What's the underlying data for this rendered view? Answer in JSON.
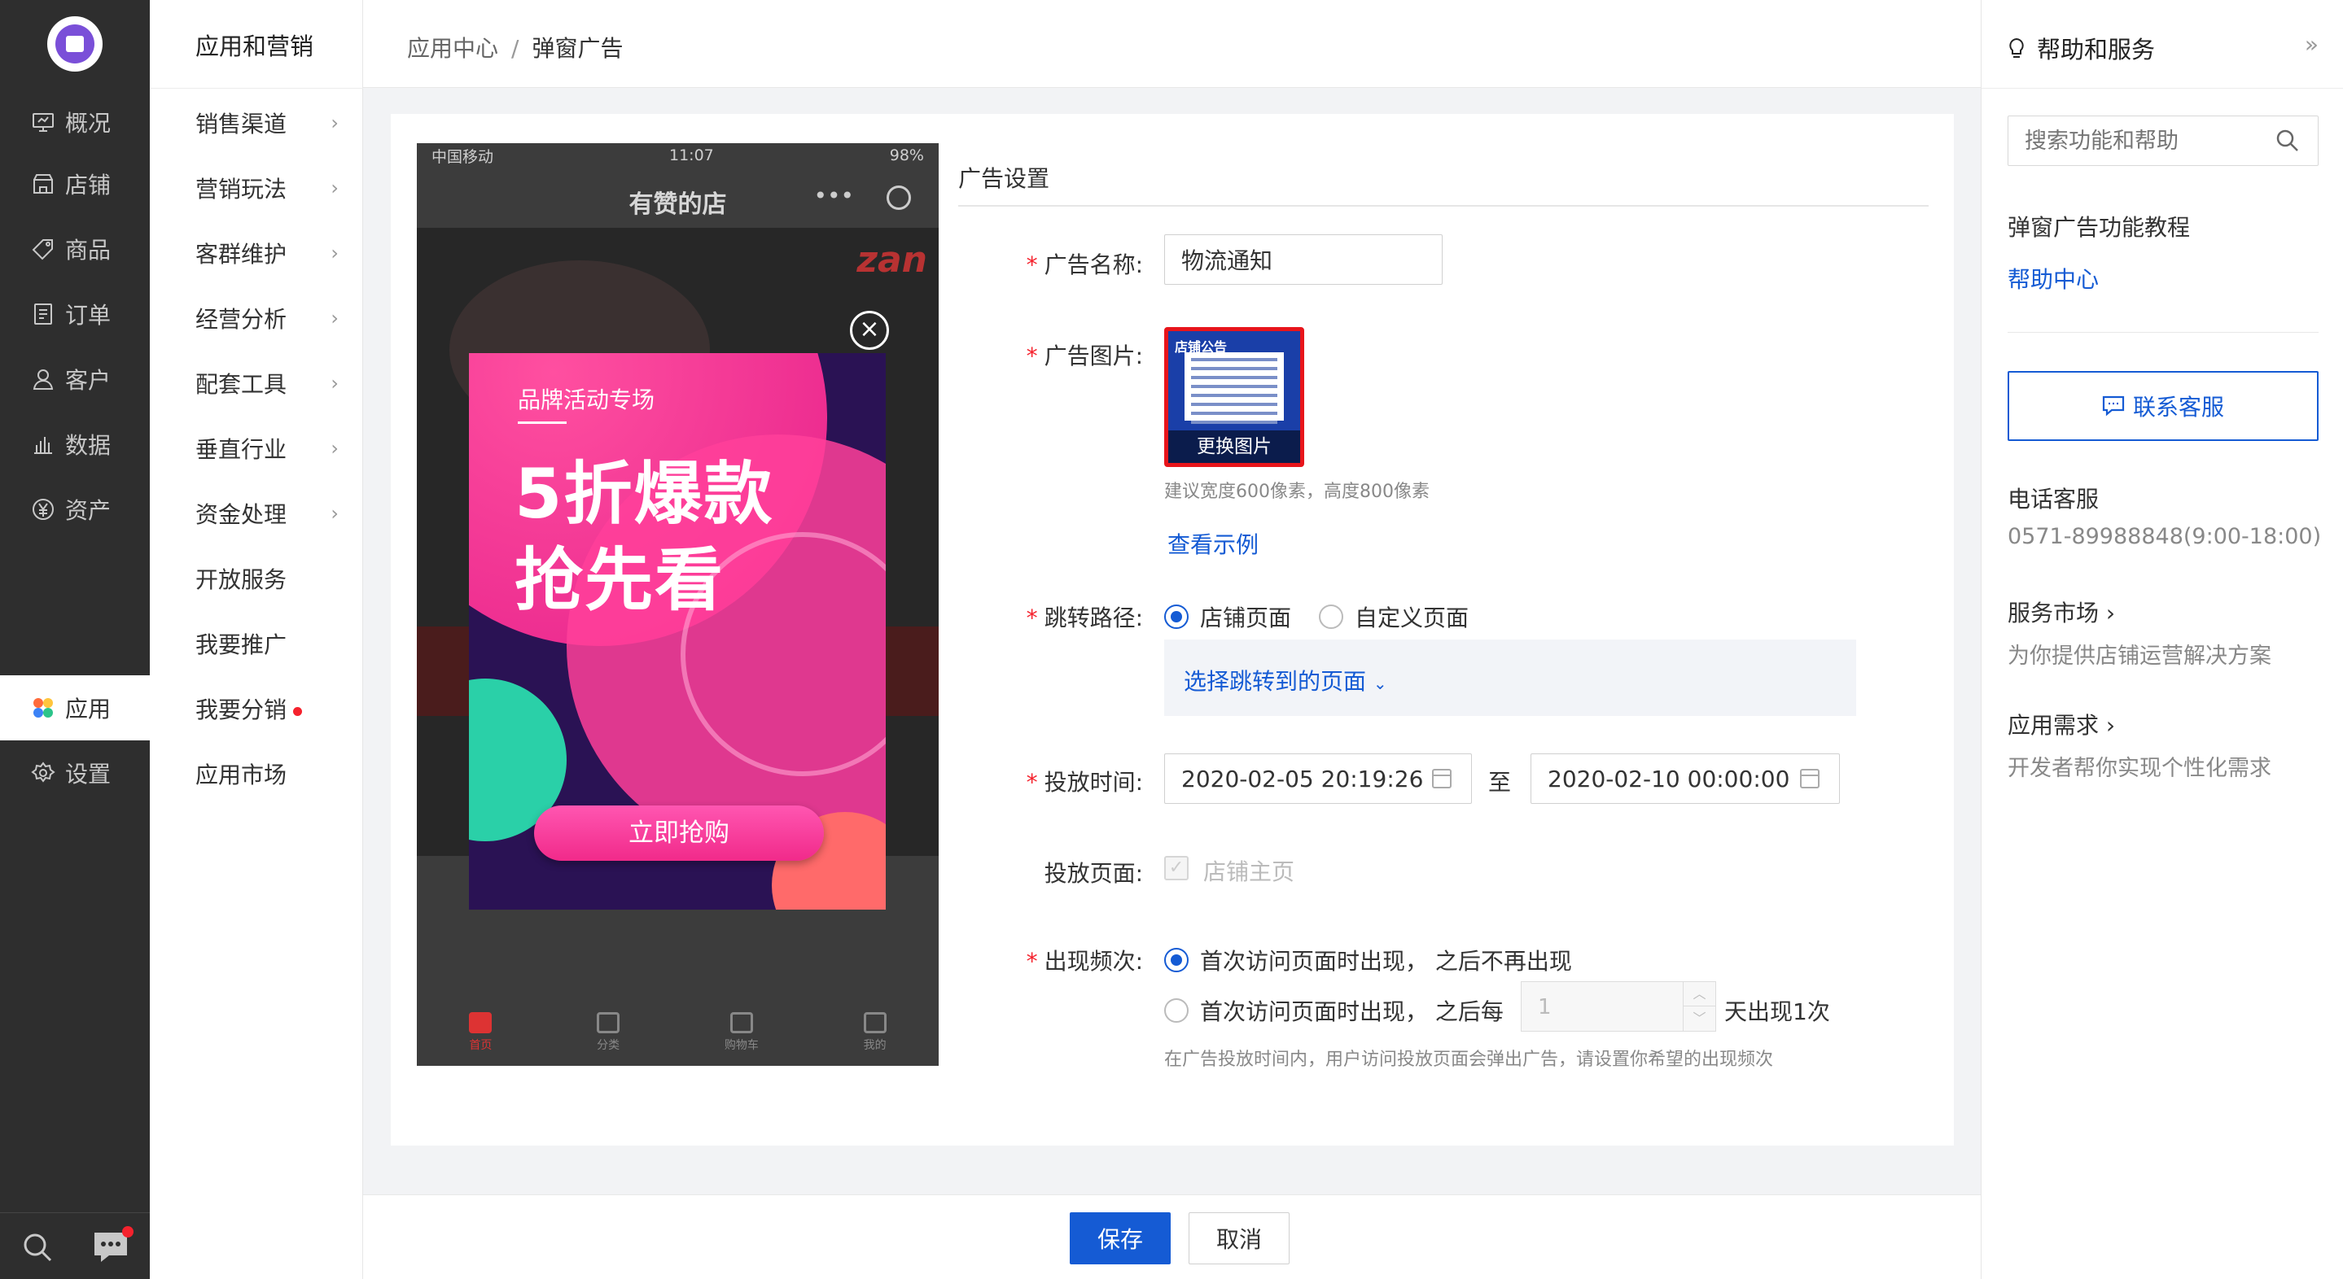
{
  "sidebar": {
    "items": [
      {
        "label": "概况",
        "icon": "monitor-icon"
      },
      {
        "label": "店铺",
        "icon": "store-icon"
      },
      {
        "label": "商品",
        "icon": "tag-icon"
      },
      {
        "label": "订单",
        "icon": "order-icon"
      },
      {
        "label": "客户",
        "icon": "user-icon"
      },
      {
        "label": "数据",
        "icon": "chart-icon"
      },
      {
        "label": "资产",
        "icon": "yen-icon"
      },
      {
        "label": "应用",
        "icon": "apps-icon"
      },
      {
        "label": "设置",
        "icon": "gear-icon"
      }
    ],
    "active": "应用"
  },
  "subnav": {
    "title": "应用和营销",
    "items": [
      {
        "label": "销售渠道"
      },
      {
        "label": "营销玩法"
      },
      {
        "label": "客群维护"
      },
      {
        "label": "经营分析"
      },
      {
        "label": "配套工具"
      },
      {
        "label": "垂直行业"
      },
      {
        "label": "资金处理"
      },
      {
        "label": "开放服务"
      },
      {
        "label": "我要推广"
      },
      {
        "label": "我要分销"
      },
      {
        "label": "应用市场"
      }
    ]
  },
  "breadcrumb": {
    "parent": "应用中心",
    "separator": "/",
    "current": "弹窗广告"
  },
  "preview": {
    "status_carrier": "中国移动",
    "status_time": "11:07",
    "status_battery": "98%",
    "shop_title": "有赞的店",
    "brand_mark": "zan",
    "ad_subtitle": "品牌活动专场",
    "ad_line1": "5折爆款",
    "ad_line2": "抢先看",
    "ad_button": "立即抢购",
    "tabs": [
      "首页",
      "分类",
      "购物车",
      "我的"
    ]
  },
  "form": {
    "section_title": "广告设置",
    "name_label": "广告名称:",
    "name_value": "物流通知",
    "image_label": "广告图片:",
    "image_header": "店铺公告",
    "image_change": "更换图片",
    "image_hint": "建议宽度600像素，高度800像素",
    "view_example": "查看示例",
    "jump_label": "跳转路径:",
    "jump_option1": "店铺页面",
    "jump_option2": "自定义页面",
    "jump_select": "选择跳转到的页面",
    "time_label": "投放时间:",
    "time_start": "2020-02-05 20:19:26",
    "time_to": "至",
    "time_end": "2020-02-10 00:00:00",
    "page_label": "投放页面:",
    "page_option": "店铺主页",
    "freq_label": "出现频次:",
    "freq_option1": "首次访问页面时出现， 之后不再出现",
    "freq_option2_prefix": "首次访问页面时出现， 之后每",
    "freq_days": "1",
    "freq_option2_suffix": "天出现1次",
    "freq_hint": "在广告投放时间内，用户访问投放页面会弹出广告，请设置你希望的出现频次"
  },
  "actions": {
    "save": "保存",
    "cancel": "取消"
  },
  "help": {
    "title": "帮助和服务",
    "search_placeholder": "搜索功能和帮助",
    "tutorial_title": "弹窗广告功能教程",
    "help_center": "帮助中心",
    "contact_button": "联系客服",
    "phone_title": "电话客服",
    "phone_value": "0571-89988848(9:00-18:00)",
    "market_title": "服务市场 ›",
    "market_desc": "为你提供店铺运营解决方案",
    "demand_title": "应用需求 ›",
    "demand_desc": "开发者帮你实现个性化需求"
  },
  "colors": {
    "primary": "#155bd4",
    "sidebar_bg": "#2e2e2e",
    "required": "#f5222d",
    "ad_pink": "#ff3f9a"
  }
}
